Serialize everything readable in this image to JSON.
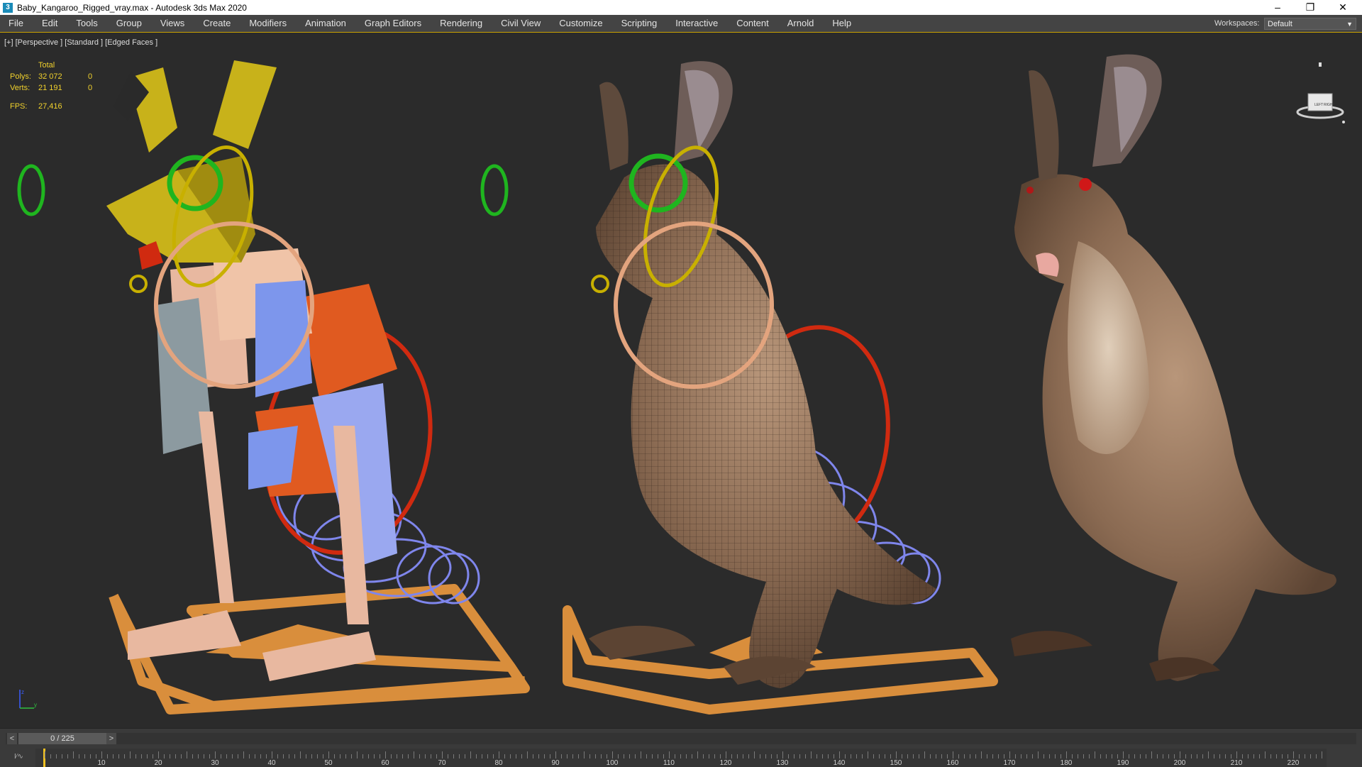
{
  "window": {
    "title": "Baby_Kangaroo_Rigged_vray.max - Autodesk 3ds Max 2020",
    "app_icon": "3",
    "minimize": "–",
    "restore": "❐",
    "close": "✕"
  },
  "menu": [
    "File",
    "Edit",
    "Tools",
    "Group",
    "Views",
    "Create",
    "Modifiers",
    "Animation",
    "Graph Editors",
    "Rendering",
    "Civil View",
    "Customize",
    "Scripting",
    "Interactive",
    "Content",
    "Arnold",
    "Help"
  ],
  "workspace": {
    "label": "Workspaces:",
    "value": "Default"
  },
  "viewport": {
    "label": "[+] [Perspective ] [Standard ] [Edged Faces ]",
    "stats": {
      "header": "Total",
      "polys_label": "Polys:",
      "polys_value": "32 072",
      "polys_sel": "0",
      "verts_label": "Verts:",
      "verts_value": "21 191",
      "verts_sel": "0",
      "fps_label": "FPS:",
      "fps_value": "27,416"
    },
    "navcube": {
      "left": "LEFT",
      "right": "RIGHT"
    },
    "axis": {
      "z": "z",
      "y": "y"
    }
  },
  "timeline": {
    "frame": "0 / 225",
    "prev": "<",
    "next": ">",
    "ruler_labels": [
      "10",
      "20",
      "30",
      "40",
      "50",
      "60",
      "70",
      "80",
      "90",
      "100",
      "110",
      "120",
      "130",
      "140",
      "150",
      "160",
      "170",
      "180",
      "190",
      "200",
      "210",
      "220"
    ],
    "mini_icon": "I∕∿"
  },
  "colors": {
    "accent": "#c9a200",
    "viewport_bg": "#2b2b2b",
    "stats_text": "#f2d22c",
    "ctrl_green": "#1fb51f",
    "ctrl_yellow": "#c8b000",
    "ctrl_orange": "#e3a47e",
    "ctrl_red": "#d02a10",
    "ctrl_blue": "#8080f0",
    "ctrl_base": "#e08a30"
  }
}
